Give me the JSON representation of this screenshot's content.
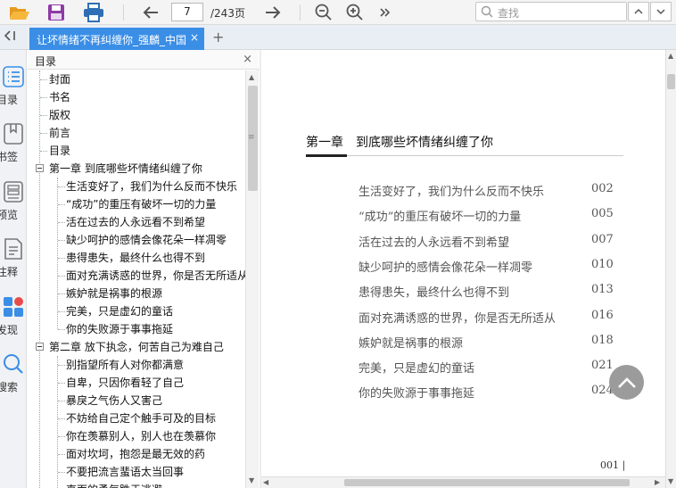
{
  "toolbar": {
    "open_icon": "folder-open-icon",
    "save_icon": "save-icon",
    "print_icon": "print-icon",
    "current_page": "7",
    "total_pages": "/243页",
    "search_placeholder": "查找"
  },
  "tab": {
    "title": "让坏情绪不再纠缠你_强麟_中国",
    "close": "×",
    "add": "+"
  },
  "rail": [
    {
      "icon": "toc-icon",
      "label": "目录"
    },
    {
      "icon": "bookmark-icon",
      "label": "书签"
    },
    {
      "icon": "preview-icon",
      "label": "预览"
    },
    {
      "icon": "annotation-icon",
      "label": "注释"
    },
    {
      "icon": "discover-icon",
      "label": "发现"
    },
    {
      "icon": "search-icon",
      "label": "搜索"
    }
  ],
  "toc": {
    "header": "目录",
    "close": "×",
    "items": [
      {
        "label": "封面",
        "level": 0
      },
      {
        "label": "书名",
        "level": 0
      },
      {
        "label": "版权",
        "level": 0
      },
      {
        "label": "前言",
        "level": 0
      },
      {
        "label": "目录",
        "level": 0
      },
      {
        "label": "第一章 到底哪些坏情绪纠缠了你",
        "level": 0
      },
      {
        "label": "生活变好了，我们为什么反而不快乐",
        "level": 1
      },
      {
        "label": "“成功”的重压有破坏一切的力量",
        "level": 1
      },
      {
        "label": "活在过去的人永远看不到希望",
        "level": 1
      },
      {
        "label": "缺少呵护的感情会像花朵一样凋零",
        "level": 1
      },
      {
        "label": "患得患失，最终什么也得不到",
        "level": 1
      },
      {
        "label": "面对充满诱惑的世界，你是否无所适从",
        "level": 1
      },
      {
        "label": "嫉妒就是祸事的根源",
        "level": 1
      },
      {
        "label": "完美，只是虚幻的童话",
        "level": 1
      },
      {
        "label": "你的失败源于事事拖延",
        "level": 1
      },
      {
        "label": "第二章 放下执念，何苦自己为难自己",
        "level": 0
      },
      {
        "label": "别指望所有人对你都满意",
        "level": 1
      },
      {
        "label": "自卑，只因你看轻了自己",
        "level": 1
      },
      {
        "label": "暴戾之气伤人又害己",
        "level": 1
      },
      {
        "label": "不妨给自己定个触手可及的目标",
        "level": 1
      },
      {
        "label": "你在羡慕别人，别人也在羡慕你",
        "level": 1
      },
      {
        "label": "面对坎坷，抱怨是最无效的药",
        "level": 1
      },
      {
        "label": "不要把流言蜚语太当回事",
        "level": 1
      },
      {
        "label": "直面的勇气胜于逃避",
        "level": 1
      }
    ]
  },
  "document": {
    "chapter_title": "第一章　到底哪些坏情绪纠缠了你",
    "entries": [
      {
        "title": "生活变好了，我们为什么反而不快乐",
        "page": "002"
      },
      {
        "title": "“成功”的重压有破坏一切的力量",
        "page": "005"
      },
      {
        "title": "活在过去的人永远看不到希望",
        "page": "007"
      },
      {
        "title": "缺少呵护的感情会像花朵一样凋零",
        "page": "010"
      },
      {
        "title": "患得患失，最终什么也得不到",
        "page": "013"
      },
      {
        "title": "面对充满诱惑的世界，你是否无所适从",
        "page": "016"
      },
      {
        "title": "嫉妒就是祸事的根源",
        "page": "018"
      },
      {
        "title": "完美，只是虚幻的童话",
        "page": "021"
      },
      {
        "title": "你的失败源于事事拖延",
        "page": "024"
      }
    ],
    "page_footer": "001 |"
  },
  "colors": {
    "accent": "#3a8ee6",
    "save": "#8e3aa6",
    "folder": "#f0a830",
    "print": "#2f6fb5"
  }
}
